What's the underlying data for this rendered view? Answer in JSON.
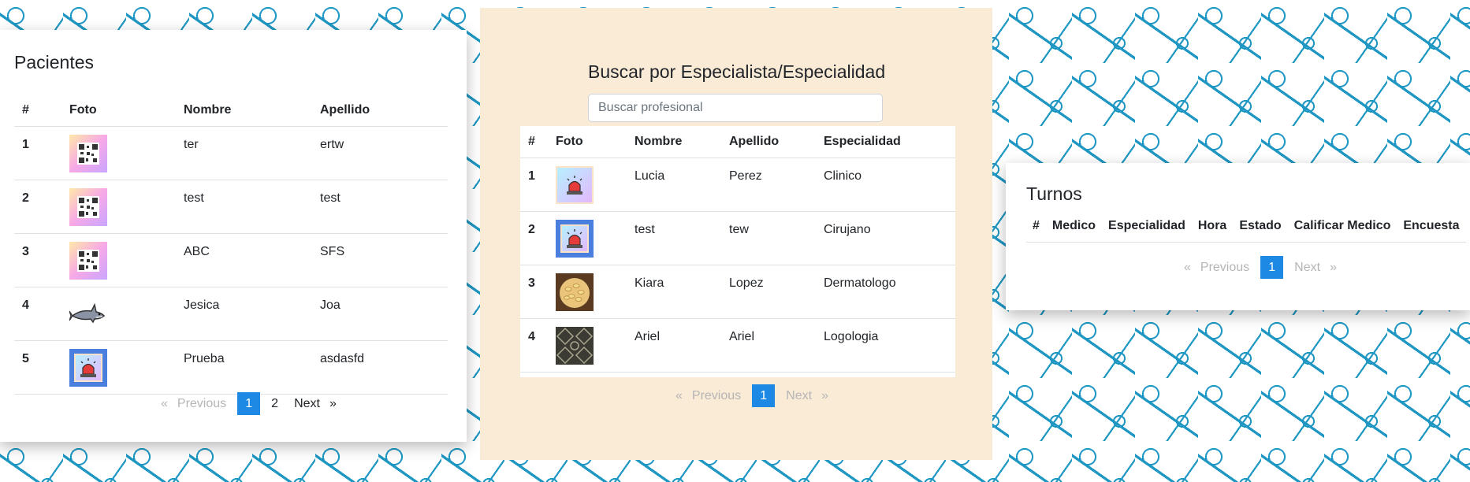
{
  "pacientes": {
    "title": "Pacientes",
    "headers": [
      "#",
      "Foto",
      "Nombre",
      "Apellido"
    ],
    "rows": [
      {
        "n": "1",
        "foto": "qr-code-image",
        "nombre": "ter",
        "apellido": "ertw"
      },
      {
        "n": "2",
        "foto": "qr-code-image",
        "nombre": "test",
        "apellido": "test"
      },
      {
        "n": "3",
        "foto": "qr-code-image",
        "nombre": "ABC",
        "apellido": "SFS"
      },
      {
        "n": "4",
        "foto": "shark-image",
        "nombre": "Jesica",
        "apellido": "Joa"
      },
      {
        "n": "5",
        "foto": "siren-image",
        "nombre": "Prueba",
        "apellido": "asdasfd"
      }
    ],
    "pagination": {
      "prev_symbol": "«",
      "prev": "Previous",
      "current": "1",
      "page2": "2",
      "next": "Next",
      "next_symbol": "»"
    }
  },
  "especialistas": {
    "title": "Buscar por Especialista/Especialidad",
    "search_placeholder": "Buscar profesional",
    "headers": [
      "#",
      "Foto",
      "Nombre",
      "Apellido",
      "Especialidad"
    ],
    "rows": [
      {
        "n": "1",
        "foto": "siren-image",
        "nombre": "Lucia",
        "apellido": "Perez",
        "especialidad": "Clinico"
      },
      {
        "n": "2",
        "foto": "siren-image",
        "nombre": "test",
        "apellido": "tew",
        "especialidad": "Cirujano"
      },
      {
        "n": "3",
        "foto": "pasta-image",
        "nombre": "Kiara",
        "apellido": "Lopez",
        "especialidad": "Dermatologo"
      },
      {
        "n": "4",
        "foto": "pattern-image",
        "nombre": "Ariel",
        "apellido": "Ariel",
        "especialidad": "Logologia"
      }
    ],
    "pagination": {
      "prev_symbol": "«",
      "prev": "Previous",
      "current": "1",
      "next": "Next",
      "next_symbol": "»"
    }
  },
  "turnos": {
    "title": "Turnos",
    "headers": [
      "#",
      "Medico",
      "Especialidad",
      "Hora",
      "Estado",
      "Calificar Medico",
      "Encuesta"
    ],
    "pagination": {
      "prev_symbol": "«",
      "prev": "Previous",
      "current": "1",
      "next": "Next",
      "next_symbol": "»"
    }
  },
  "colors": {
    "accent": "#1e88e5",
    "pattern": "#1f97c2",
    "panel": "#faebd7"
  }
}
